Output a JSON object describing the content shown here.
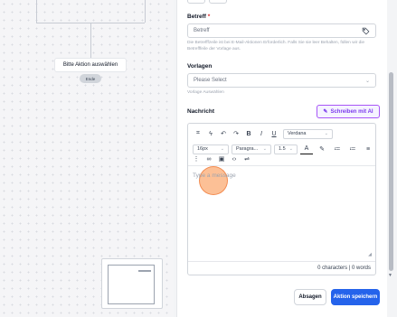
{
  "canvas": {
    "node_label": "Bitte Aktion auswählen",
    "end_label": "Ende"
  },
  "form": {
    "subject": {
      "label": "Betreff",
      "required_marker": "*",
      "placeholder": "Betreff",
      "helper": "Die Betrefffzeile ist bei E-Mail-Aktionen Erforderlich. Falls Sie sie leer Behalten, füllen wir die Betrefffeile der Vorlage aus."
    },
    "templates": {
      "label": "Vorlagen",
      "selected": "Please Select",
      "helper": "Vorlage Auswählen"
    },
    "message": {
      "label": "Nachricht",
      "ai_button": "Schreiben mit AI",
      "placeholder": "Type a message",
      "counter": "0 characters | 0 words"
    },
    "toolbar": {
      "font_family": "Verdana",
      "font_size": "16px",
      "block_format": "Paragra...",
      "line_height": "1.5"
    }
  },
  "footer": {
    "cancel": "Absagen",
    "save": "Aktion speichern"
  },
  "colors": {
    "primary": "#2563eb",
    "ai_accent": "#a855f7",
    "cursor": "#f97316"
  }
}
